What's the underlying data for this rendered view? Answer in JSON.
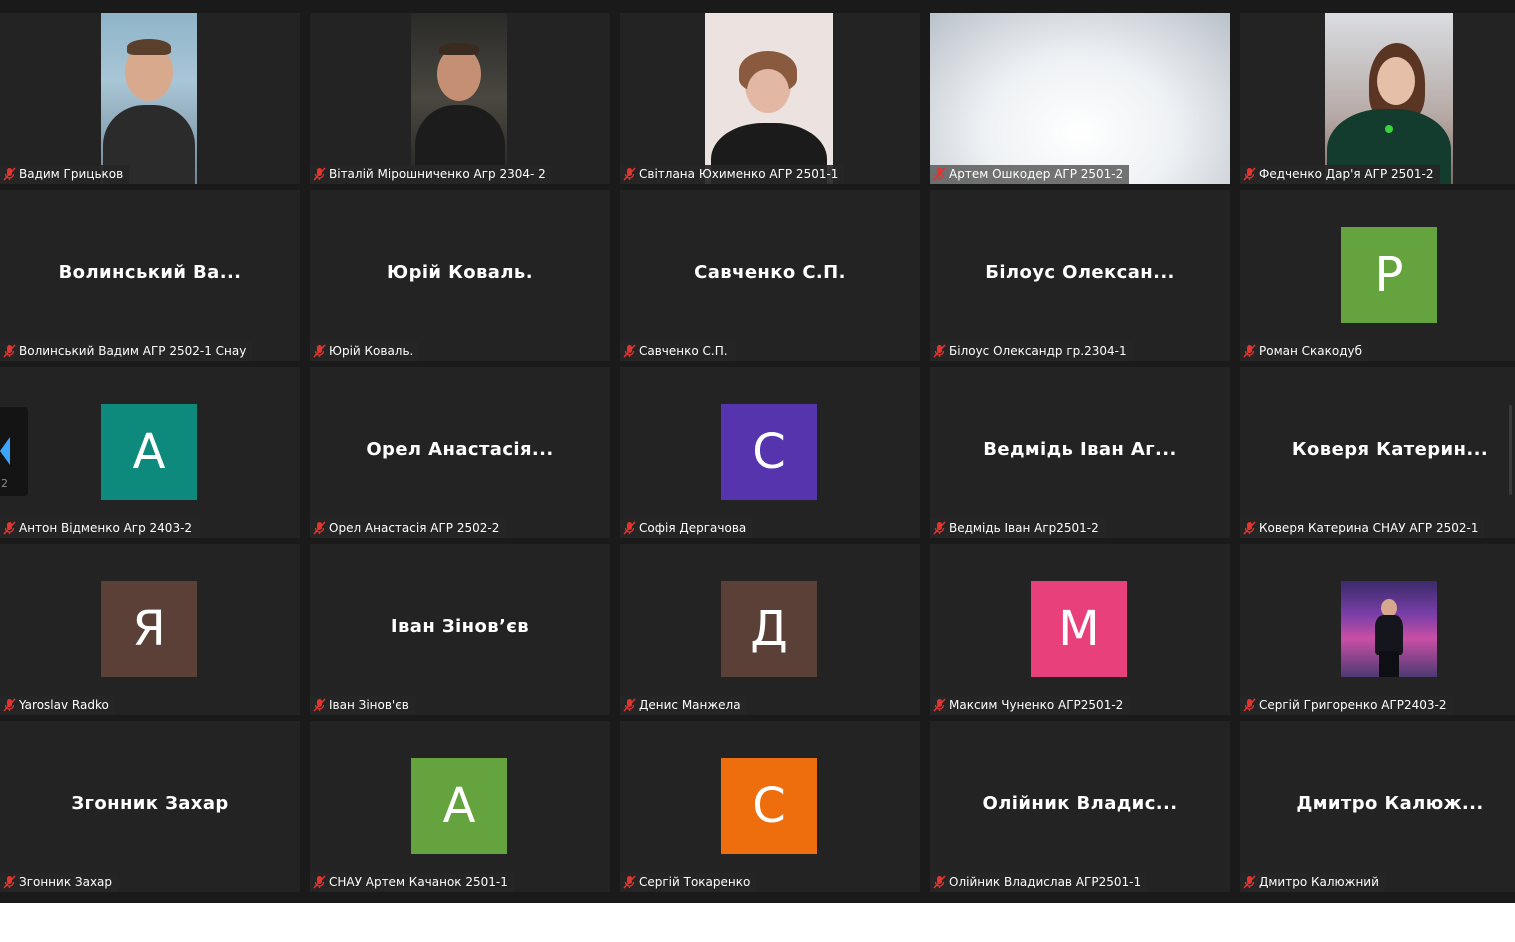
{
  "participants": [
    {
      "display_name": "Вадим Грицьков",
      "muted": true,
      "type": "video"
    },
    {
      "display_name": "Віталій Мірошниченко Агр 2304- 2",
      "muted": true,
      "type": "video"
    },
    {
      "display_name": "Світлана Юхименко АГР 2501-1",
      "muted": true,
      "type": "video"
    },
    {
      "display_name": "Артем Ошкодер АГР 2501-2",
      "muted": true,
      "type": "video"
    },
    {
      "display_name": "Федченко Дар'я АГР 2501-2",
      "muted": true,
      "type": "video"
    },
    {
      "display_name": "Волинський Вадим АГР 2502-1 Снау",
      "center_text": "Волинський Ва...",
      "muted": true,
      "type": "name"
    },
    {
      "display_name": "Юрій Коваль.",
      "center_text": "Юрій Коваль.",
      "muted": true,
      "type": "name"
    },
    {
      "display_name": "Савченко С.П.",
      "center_text": "Савченко С.П.",
      "muted": true,
      "type": "name"
    },
    {
      "display_name": "Білоус Олександр гр.2304-1",
      "center_text": "Білоус Олексан...",
      "muted": true,
      "type": "name"
    },
    {
      "display_name": "Роман Скакодуб",
      "avatar_letter": "Р",
      "avatar_color": "#64a33d",
      "muted": true,
      "type": "avatar"
    },
    {
      "display_name": "Антон Відменко Агр 2403-2",
      "avatar_letter": "А",
      "avatar_color": "#0e8a7d",
      "muted": true,
      "type": "avatar"
    },
    {
      "display_name": "Орел Анастасія АГР 2502-2",
      "center_text": "Орел Анастасія...",
      "muted": true,
      "type": "name"
    },
    {
      "display_name": "Софія Дергачова",
      "avatar_letter": "С",
      "avatar_color": "#5634ad",
      "muted": true,
      "type": "avatar"
    },
    {
      "display_name": "Ведмідь Іван Агр2501-2",
      "center_text": "Ведмідь Іван Аг...",
      "muted": true,
      "type": "name"
    },
    {
      "display_name": "Коверя Катерина СНАУ АГР 2502-1",
      "center_text": "Коверя Катерин...",
      "muted": true,
      "type": "name"
    },
    {
      "display_name": "Yaroslav Radko",
      "avatar_letter": "Я",
      "avatar_color": "#5b4038",
      "muted": true,
      "type": "avatar"
    },
    {
      "display_name": "Іван Зінов'єв",
      "center_text": "Іван Зінов’єв",
      "muted": true,
      "type": "name"
    },
    {
      "display_name": "Денис Манжела",
      "avatar_letter": "Д",
      "avatar_color": "#5b4038",
      "muted": true,
      "type": "avatar"
    },
    {
      "display_name": "Максим Чуненко АГР2501-2",
      "avatar_letter": "М",
      "avatar_color": "#e8407a",
      "muted": true,
      "type": "avatar"
    },
    {
      "display_name": "Сергій Григоренко АГР2403-2",
      "muted": true,
      "type": "avatar-photo"
    },
    {
      "display_name": "Згонник Захар",
      "center_text": "Згонник Захар",
      "muted": true,
      "type": "name"
    },
    {
      "display_name": "СНАУ Артем Качанок 2501-1",
      "avatar_letter": "А",
      "avatar_color": "#64a33d",
      "muted": true,
      "type": "avatar"
    },
    {
      "display_name": "Сергій Токаренко",
      "avatar_letter": "С",
      "avatar_color": "#ee6d0c",
      "muted": true,
      "type": "avatar"
    },
    {
      "display_name": "Олійник Владислав АГР2501-1",
      "center_text": "Олійник Владис...",
      "muted": true,
      "type": "name"
    },
    {
      "display_name": "Дмитро Калюжний",
      "center_text": "Дмитро Калюж...",
      "muted": true,
      "type": "name"
    }
  ],
  "pager": {
    "page_label": "2",
    "icon": "chevron-left-icon",
    "accent_color": "#3aa4ff"
  },
  "colors": {
    "muted_mic": "#e3342f",
    "tile_bg": "#232323",
    "grid_bg": "#1a1a1a"
  }
}
